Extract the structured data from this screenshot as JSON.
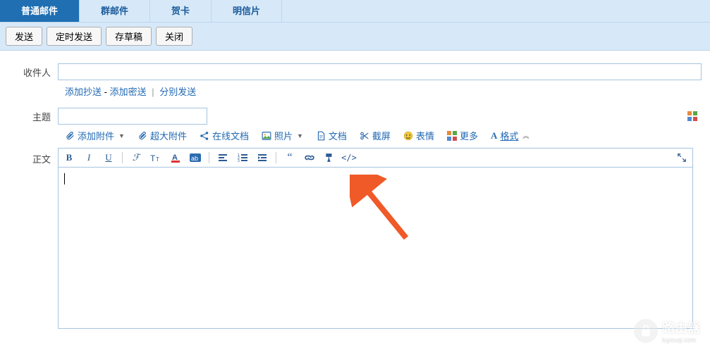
{
  "tabs": {
    "items": [
      "普通邮件",
      "群邮件",
      "贺卡",
      "明信片"
    ],
    "active": 0
  },
  "toolbar": [
    "发送",
    "定时发送",
    "存草稿",
    "关闭"
  ],
  "labels": {
    "to": "收件人",
    "subject": "主题",
    "body": "正文"
  },
  "links": {
    "cc": "添加抄送",
    "bcc": "添加密送",
    "sep1": " - ",
    "sep2": " | ",
    "split": "分别发送"
  },
  "attach": {
    "add": "添加附件",
    "big": "超大附件",
    "online": "在线文档",
    "photo": "照片",
    "doc": "文档",
    "screenshot": "截屏",
    "emoji": "表情",
    "more": "更多",
    "format": "格式"
  },
  "editor_icons": [
    "bold",
    "italic",
    "underline",
    "strikeout",
    "font-size",
    "font-color",
    "highlight",
    "align",
    "list-ol",
    "list-ul",
    "quote",
    "link",
    "video",
    "code"
  ],
  "watermark": {
    "title": "路由器",
    "sub": "luyouqi.com"
  }
}
